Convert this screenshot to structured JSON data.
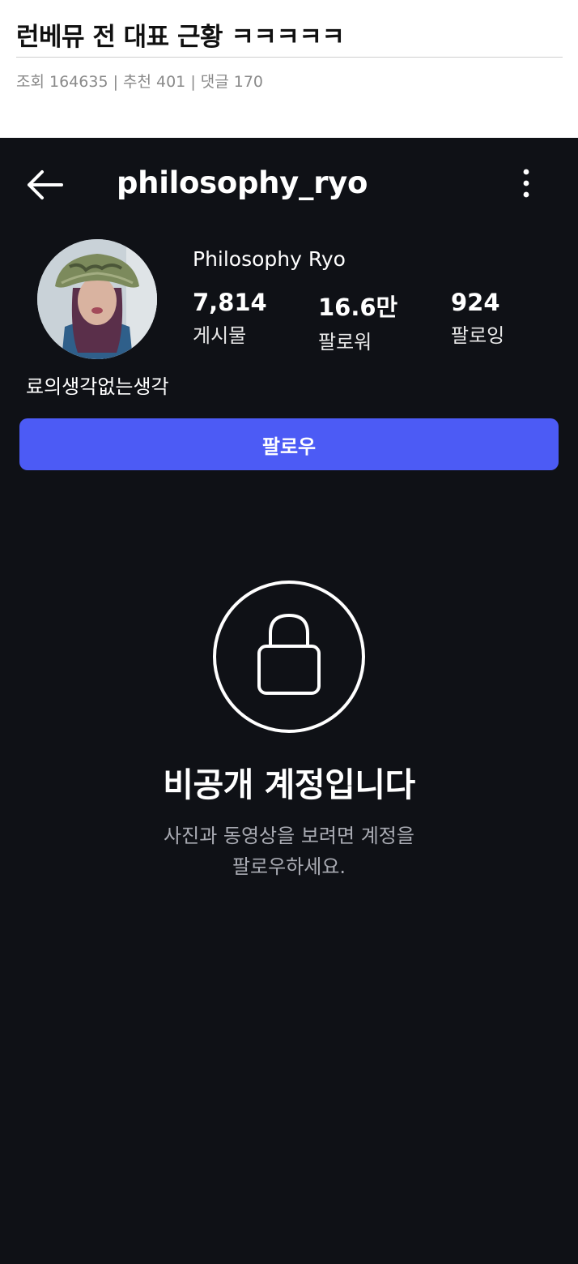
{
  "post": {
    "title": "런베뮤 전 대표 근황 ㅋㅋㅋㅋㅋ",
    "meta": "조회 164635 | 추천 401 | 댓글 170"
  },
  "profile": {
    "username": "philosophy_ryo",
    "display_name": "Philosophy Ryo",
    "stats": {
      "posts_value": "7,814",
      "posts_label": "게시물",
      "followers_value": "16.6만",
      "followers_label": "팔로워",
      "following_value": "924",
      "following_label": "팔로잉"
    },
    "bio": "료의생각없는생각",
    "follow_label": "팔로우"
  },
  "private": {
    "title": "비공개 계정입니다",
    "line1": "사진과 동영상을 보려면 계정을",
    "line2": "팔로우하세요."
  },
  "icons": {
    "back": "arrow-left-icon",
    "more": "more-vertical-icon",
    "lock": "lock-icon"
  },
  "colors": {
    "background_dark": "#0f1116",
    "follow_button": "#4c5bf5",
    "secondary_text": "#a9abb3"
  }
}
